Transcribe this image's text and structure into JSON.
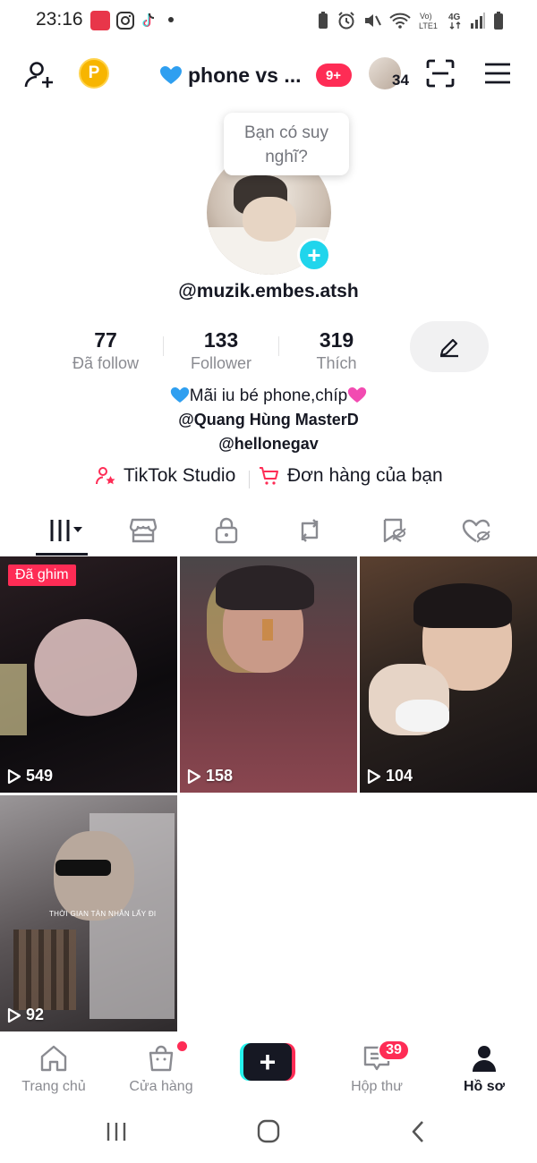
{
  "status_bar": {
    "time": "23:16",
    "app_icons": [
      "manga-toon-icon",
      "instagram-icon",
      "tiktok-icon"
    ],
    "network": "4G",
    "volte": "Vo) LTE1"
  },
  "header": {
    "account_name": "phone vs ...",
    "notification_badge": "9+",
    "friends_count": "34",
    "coin_label": "P"
  },
  "profile": {
    "tooltip_line1": "Bạn có suy",
    "tooltip_line2": "nghĩ?",
    "username": "@muzik.embes.atsh"
  },
  "stats": [
    {
      "value": "77",
      "label": "Đã follow"
    },
    {
      "value": "133",
      "label": "Follower"
    },
    {
      "value": "319",
      "label": "Thích"
    }
  ],
  "bio": {
    "line1": "Mãi iu bé phone,chíp",
    "line2": "@Quang Hùng MasterD",
    "line3": "@hellonegav"
  },
  "links": {
    "studio": "TikTok Studio",
    "orders": "Đơn hàng của bạn"
  },
  "videos": [
    {
      "views": "549",
      "pinned_label": "Đã ghim"
    },
    {
      "views": "158"
    },
    {
      "views": "104"
    },
    {
      "views": "92",
      "caption": "THỜI GIAN TÀN NHẪN LẤY ĐI"
    }
  ],
  "bottom_nav": {
    "home": "Trang chủ",
    "shop": "Cửa hàng",
    "inbox": "Hộp thư",
    "inbox_badge": "39",
    "profile": "Hồ sơ"
  },
  "colors": {
    "accent_red": "#fe2c55",
    "accent_cyan": "#25f4ee",
    "text_primary": "#161823",
    "text_secondary": "#8a8b91"
  }
}
